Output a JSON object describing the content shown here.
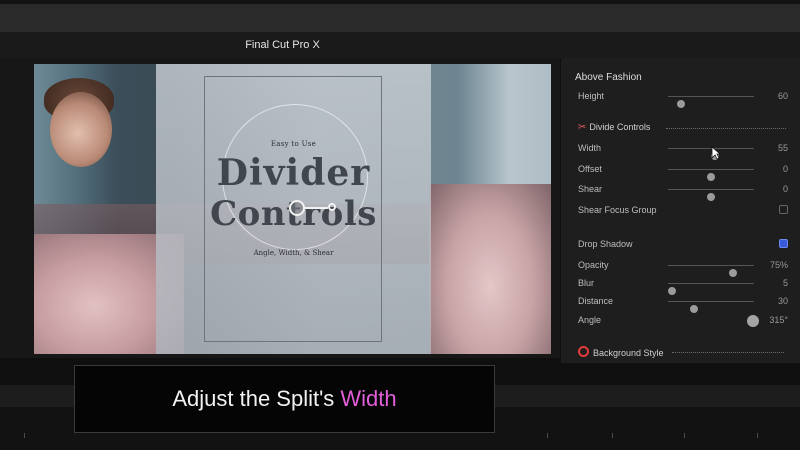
{
  "app": {
    "title": "Final Cut Pro X"
  },
  "viewer": {
    "overlay": {
      "small_top": "Easy to Use",
      "big_line1": "Divider",
      "big_line2": "Controls",
      "subtitle": "Angle, Width, & Shear"
    }
  },
  "inspector": {
    "title": "Above Fashion",
    "rows": [
      {
        "label": "Height",
        "value": "60",
        "slider": 0.15
      },
      {
        "section": "Divide Controls",
        "icon": "scissors-icon"
      },
      {
        "label": "Width",
        "value": "55",
        "slider": 0.55
      },
      {
        "label": "Offset",
        "value": "0",
        "slider": 0.5
      },
      {
        "label": "Shear",
        "value": "0",
        "slider": 0.5
      },
      {
        "label": "Shear Focus Group",
        "checked": false
      },
      {
        "label": "Drop Shadow",
        "checked": true
      },
      {
        "label": "Opacity",
        "value": "75%",
        "slider": 0.75
      },
      {
        "label": "Blur",
        "value": "5",
        "slider": 0.05
      },
      {
        "label": "Distance",
        "value": "30",
        "slider": 0.3
      },
      {
        "label": "Angle",
        "value": "315°"
      },
      {
        "section": "Background Style",
        "icon": "red-ring-icon"
      }
    ]
  },
  "caption": {
    "prefix": "Adjust the Split's ",
    "highlight": "Width"
  },
  "colors": {
    "accent": "#e15ed7",
    "checkbox_on": "#3a5bd9",
    "section_icon": "#e23b3b"
  }
}
